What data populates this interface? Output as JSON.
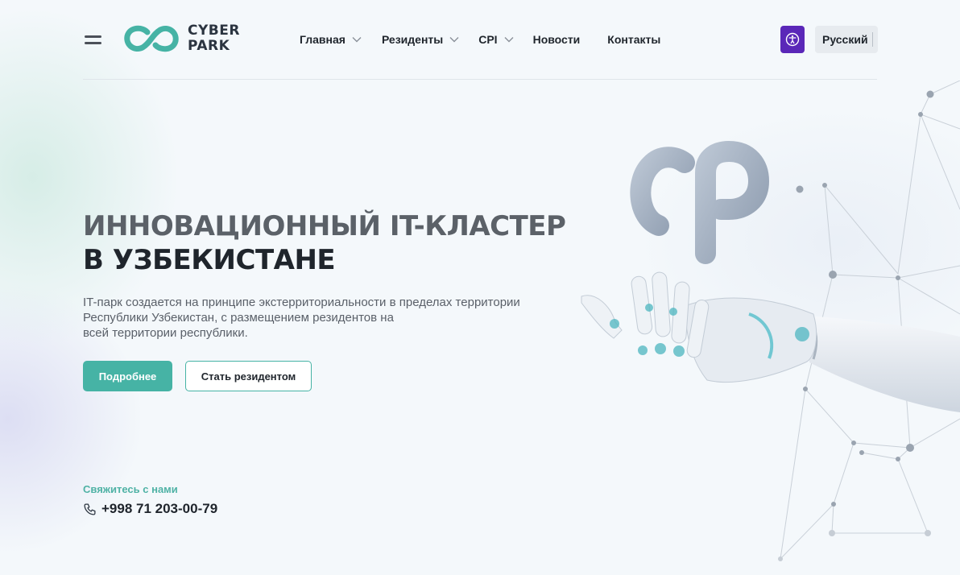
{
  "brand": {
    "line1": "CYBER",
    "line2": "PARK",
    "accent": "#46b3a5"
  },
  "nav": [
    {
      "label": "Главная",
      "has_dropdown": true
    },
    {
      "label": "Резиденты",
      "has_dropdown": true
    },
    {
      "label": "CPI",
      "has_dropdown": true
    },
    {
      "label": "Новости",
      "has_dropdown": false
    },
    {
      "label": "Контакты",
      "has_dropdown": false
    }
  ],
  "header": {
    "accessibility_icon": "accessibility-icon",
    "language": "Русский",
    "accessibility_color": "#5a27b8"
  },
  "hero": {
    "title_line1": "ИННОВАЦИОННЫЙ IT-КЛАСТЕР",
    "title_line2": "В УЗБЕКИСТАНЕ",
    "desc_line1": "IT-парк создается на принципе экстерриториальности в пределах территории",
    "desc_line2": "Республики Узбекистан, с размещением резидентов на",
    "desc_line3": "всей территории республики.",
    "primary_button": "Подробнее",
    "secondary_button": "Стать резидентом",
    "image_icon": "robot-hand-holding-cp-logo"
  },
  "contact": {
    "label": "Свяжитесь с нами",
    "phone": "+998 71 203-00-79",
    "phone_icon": "phone-icon"
  }
}
